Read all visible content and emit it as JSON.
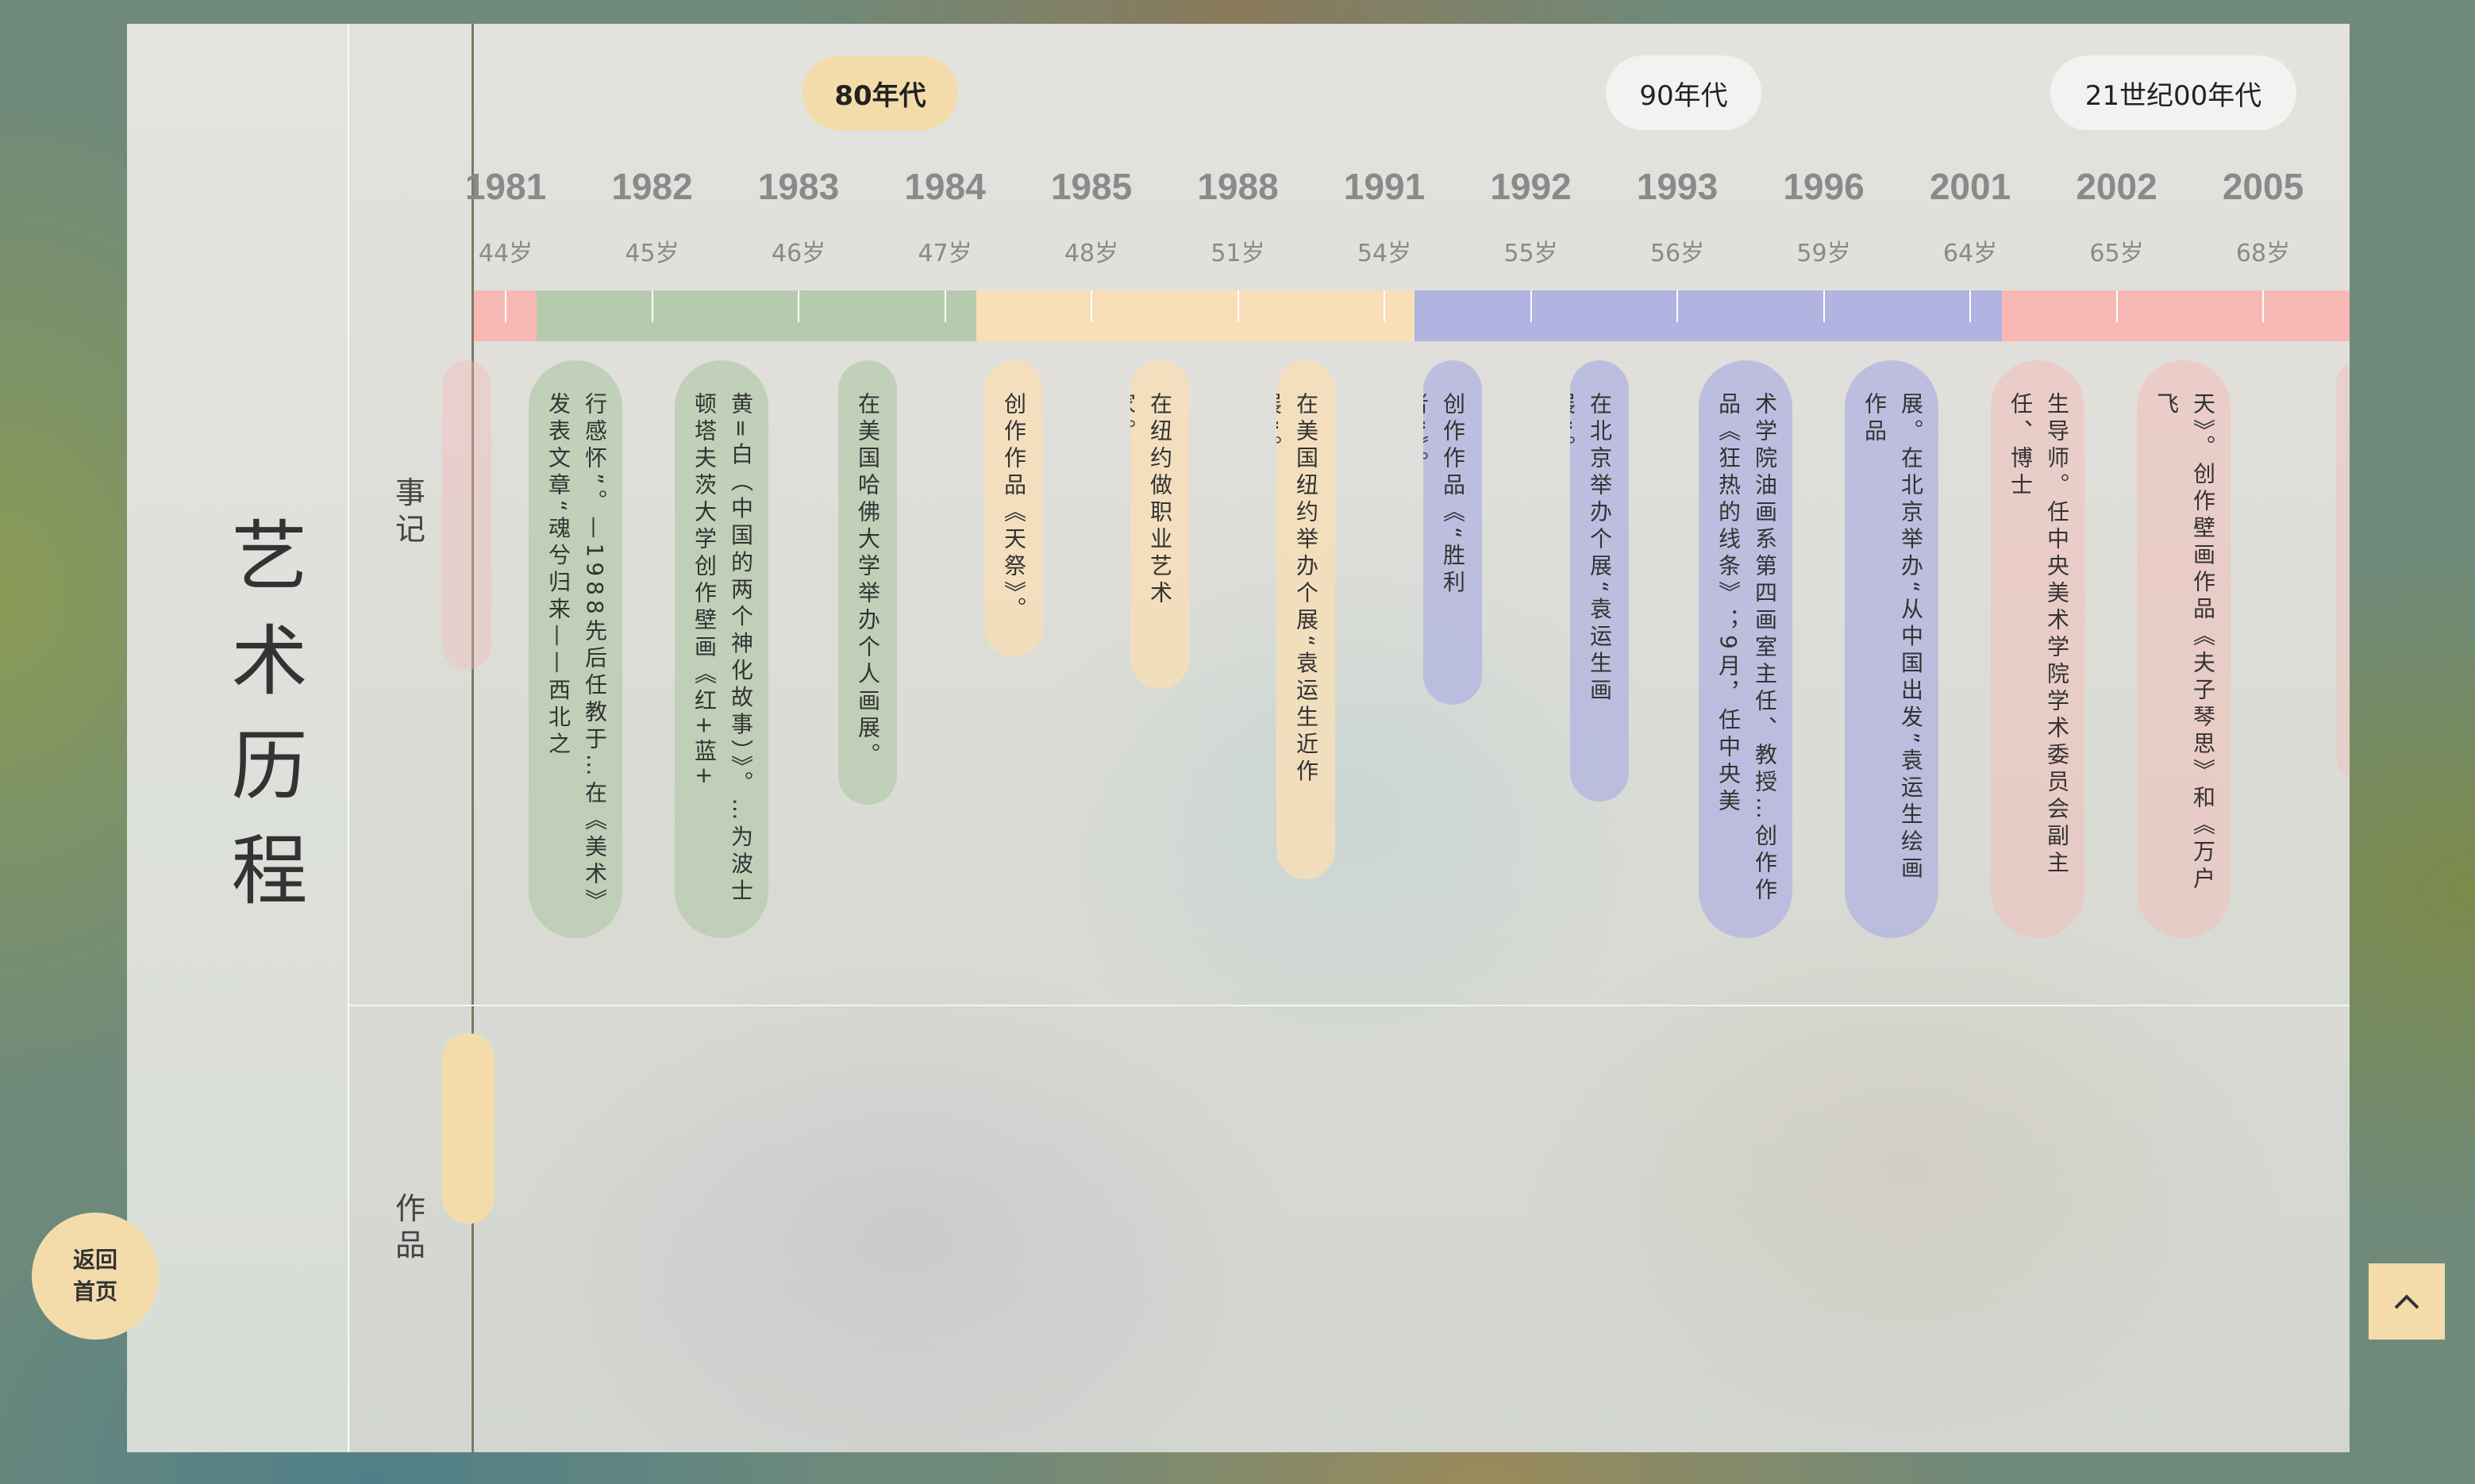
{
  "title": "艺术历程",
  "rows": {
    "events": "事记",
    "works": "作品"
  },
  "buttons": {
    "home": "返回首页",
    "top_icon": "chevron-up-icon"
  },
  "colors": {
    "gold": "#f4dcaa",
    "segments": [
      "#f7b8b4",
      "#b6cbad",
      "#f8dfb7",
      "#b1b3e0",
      "#f7b8b4"
    ]
  },
  "decades": [
    {
      "label": "80年代",
      "active": true
    },
    {
      "label": "90年代",
      "active": false
    },
    {
      "label": "21世纪00年代",
      "active": false
    }
  ],
  "years": [
    {
      "year": "1981",
      "age": "44岁"
    },
    {
      "year": "1982",
      "age": "45岁"
    },
    {
      "year": "1983",
      "age": "46岁"
    },
    {
      "year": "1984",
      "age": "47岁"
    },
    {
      "year": "1985",
      "age": "48岁"
    },
    {
      "year": "1988",
      "age": "51岁"
    },
    {
      "year": "1991",
      "age": "54岁"
    },
    {
      "year": "1992",
      "age": "55岁"
    },
    {
      "year": "1993",
      "age": "56岁"
    },
    {
      "year": "1996",
      "age": "59岁"
    },
    {
      "year": "2001",
      "age": "64岁"
    },
    {
      "year": "2002",
      "age": "65岁"
    },
    {
      "year": "2005",
      "age": "68岁"
    }
  ],
  "events": [
    {
      "text": "行感怀”。—1988先后任教于…在《美术》发表文章“魂兮归来——西北之",
      "era": 1
    },
    {
      "text": "黄=白（中国的两个神化故事）》。…为波士顿塔夫茨大学创作壁画《红+蓝+",
      "era": 1
    },
    {
      "text": "在美国哈佛大学举办个人画展。",
      "era": 1
    },
    {
      "text": "创作作品《天祭》。",
      "era": 2
    },
    {
      "text": "在纽约做职业艺术家。",
      "era": 2
    },
    {
      "text": "在美国纽约举办个展“袁运生近作展”。",
      "era": 2
    },
    {
      "text": "创作作品《“胜利者”》。",
      "era": 3
    },
    {
      "text": "在北京举办个展“袁运生画展”。",
      "era": 3
    },
    {
      "text": "术学院油画系第四画室主任、教授…创作作品《狂热的线条》；9月，任中央美",
      "era": 3
    },
    {
      "text": "展。在北京举办“从中国出发”袁运生绘画作品",
      "era": 3
    },
    {
      "text": "生导师。任中央美术学院学术委员会副主任、博士",
      "era": 4
    },
    {
      "text": "天》。创作壁画作品《夫子琴思》和《万户飞",
      "era": 4
    }
  ]
}
